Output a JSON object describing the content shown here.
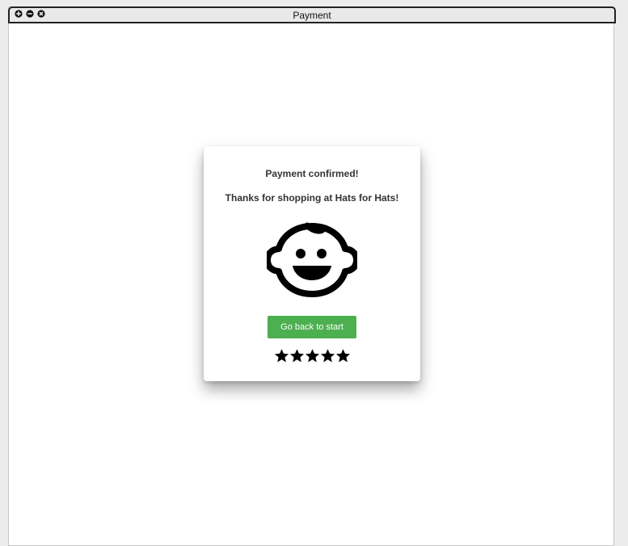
{
  "window": {
    "title": "Payment",
    "controls": [
      "maximize-icon",
      "minimize-icon",
      "close-icon"
    ]
  },
  "card": {
    "title": "Payment confirmed!",
    "subtitle": "Thanks for shopping at Hats for Hats!",
    "icon": "baby-face-icon",
    "button_label": "Go back to start",
    "rating": {
      "max": 5,
      "filled": 5
    }
  },
  "colors": {
    "button": "#4caf50",
    "text": "#333333",
    "icon": "#000000"
  }
}
